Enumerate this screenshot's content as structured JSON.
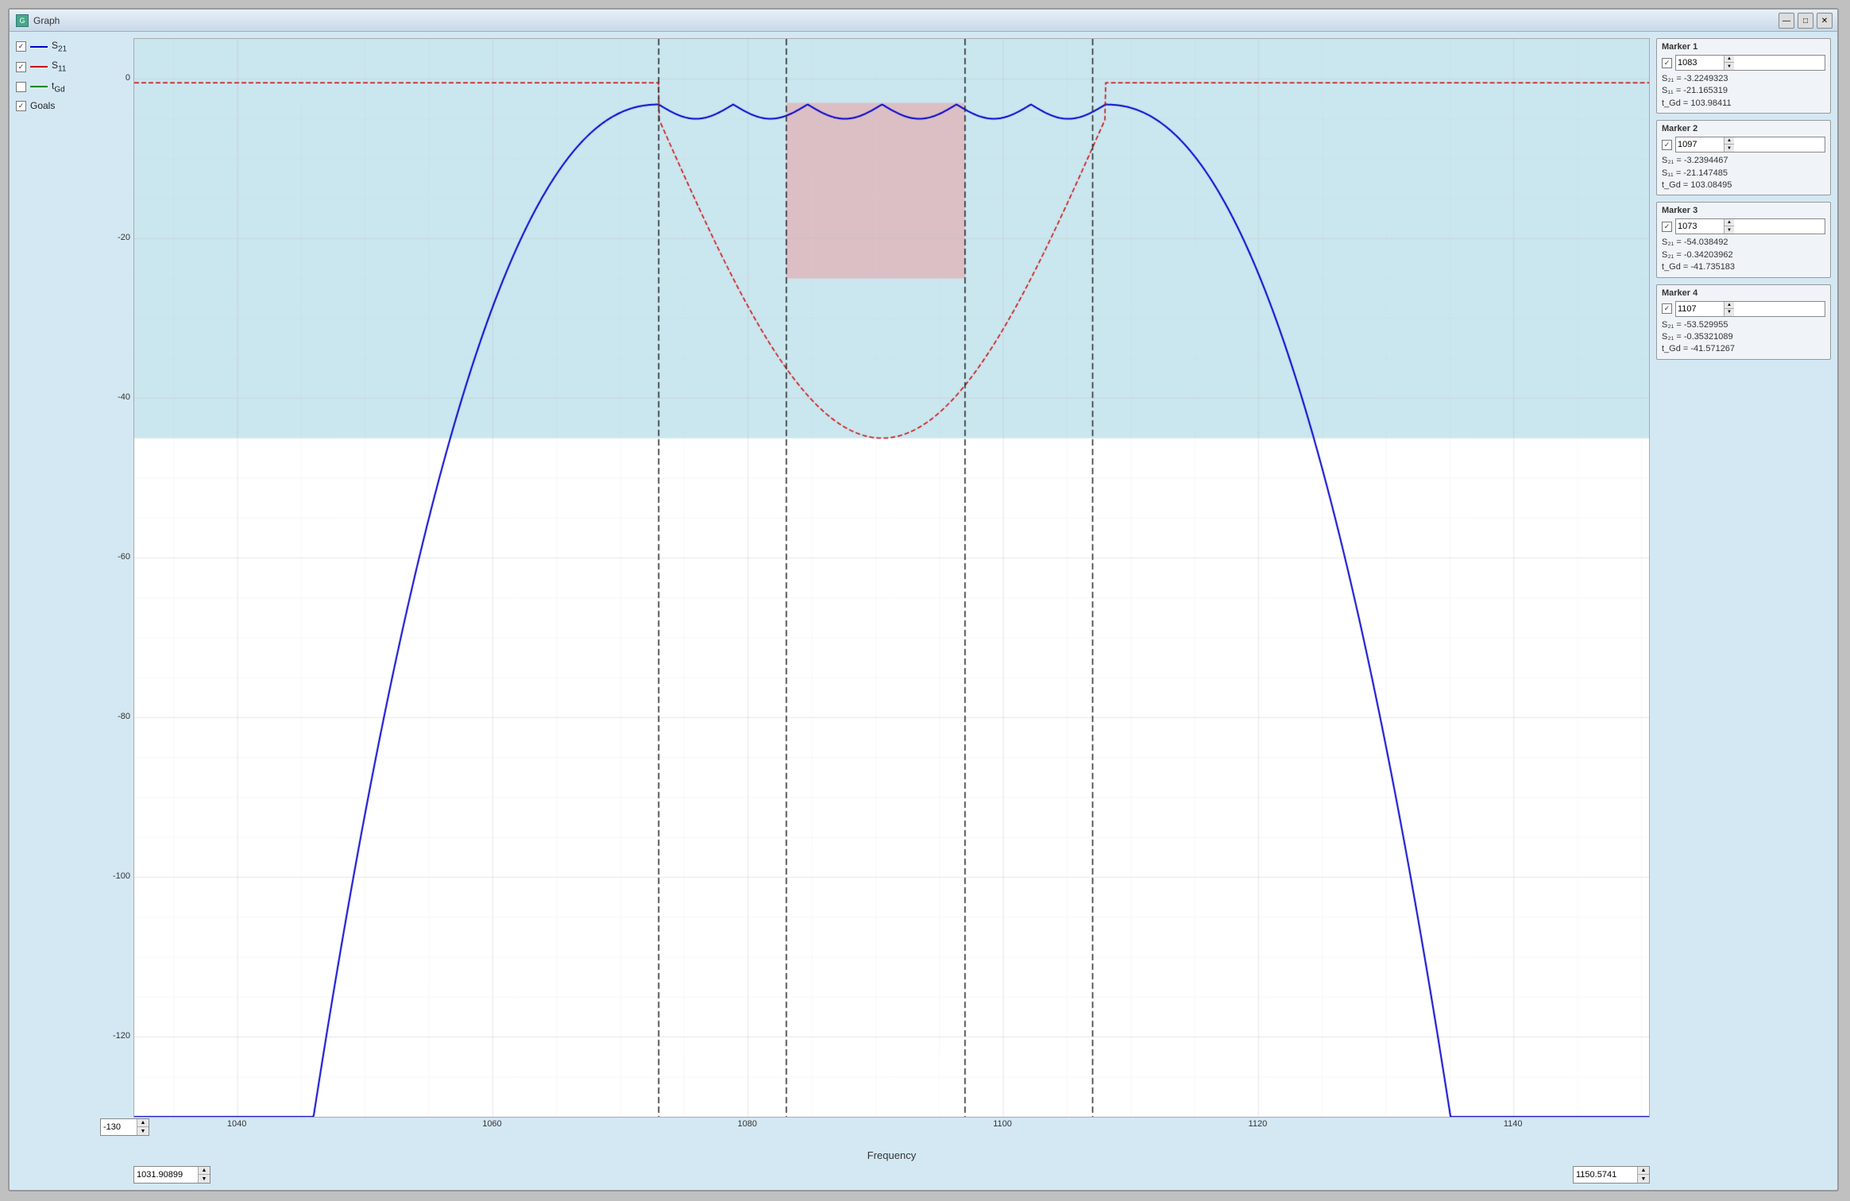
{
  "window": {
    "title": "Graph",
    "min_btn": "—",
    "max_btn": "□",
    "close_btn": "✕"
  },
  "legend": {
    "items": [
      {
        "id": "s21",
        "label": "S₂₁",
        "checked": true,
        "color": "#0000cc",
        "style": "solid"
      },
      {
        "id": "s11",
        "label": "S₁₁",
        "checked": true,
        "color": "#cc0000",
        "style": "dashed"
      },
      {
        "id": "tgd",
        "label": "t_Gd",
        "checked": false,
        "color": "#008800",
        "style": "solid"
      },
      {
        "id": "goals",
        "label": "Goals",
        "checked": true,
        "color": "#888888",
        "style": "solid"
      }
    ]
  },
  "yaxis": {
    "ticks": [
      {
        "value": 0,
        "label": "0"
      },
      {
        "value": -20,
        "label": "-20"
      },
      {
        "value": -40,
        "label": "-40"
      },
      {
        "value": -60,
        "label": "-60"
      },
      {
        "value": -80,
        "label": "-80"
      },
      {
        "value": -100,
        "label": "-100"
      },
      {
        "value": -120,
        "label": "-120"
      }
    ],
    "min_value": "-130",
    "min_label": "-130"
  },
  "xaxis": {
    "ticks": [
      {
        "value": 1040,
        "label": "1040"
      },
      {
        "value": 1060,
        "label": "1060"
      },
      {
        "value": 1080,
        "label": "1080"
      },
      {
        "value": 1100,
        "label": "1100"
      },
      {
        "value": 1120,
        "label": "1120"
      },
      {
        "value": 1140,
        "label": "1140"
      }
    ],
    "title": "Frequency",
    "x_min": "1031.90899",
    "x_max": "1150.5741"
  },
  "markers": [
    {
      "id": 1,
      "title": "Marker 1",
      "checked": true,
      "frequency": "1083",
      "s21": "S₂₁ = -3.2249323",
      "s11": "S₁₁ = -21.165319",
      "tgd": "t_Gd = 103.98411"
    },
    {
      "id": 2,
      "title": "Marker 2",
      "checked": true,
      "frequency": "1097",
      "s21": "S₂₁ = -3.2394467",
      "s11": "S₁₁ = -21.147485",
      "tgd": "t_Gd = 103.08495"
    },
    {
      "id": 3,
      "title": "Marker 3",
      "checked": true,
      "frequency": "1073",
      "s21": "S₂₁ = -54.038492",
      "s11_alt": "S₂₁ = -0.34203962",
      "tgd": "t_Gd = -41.735183"
    },
    {
      "id": 4,
      "title": "Marker 4",
      "checked": true,
      "frequency": "1107",
      "s21": "S₂₁ = -53.529955",
      "s11_alt": "S₂₁ = -0.35321089",
      "tgd": "t_Gd = -41.571267"
    }
  ]
}
